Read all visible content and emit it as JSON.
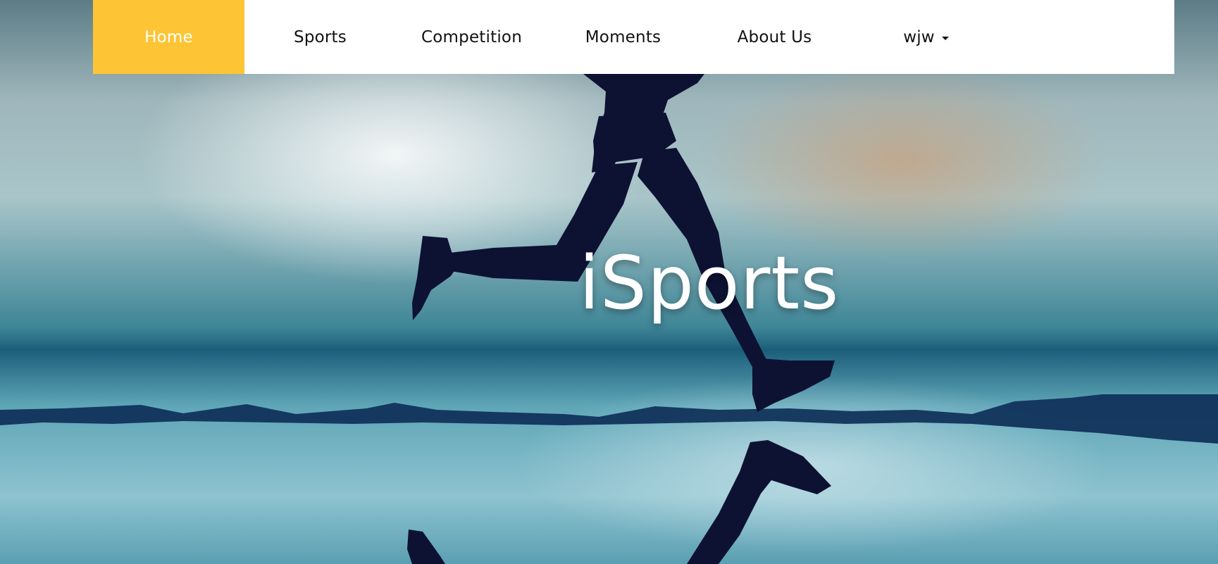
{
  "nav": {
    "items": [
      {
        "label": "Home",
        "active": true
      },
      {
        "label": "Sports",
        "active": false
      },
      {
        "label": "Competition",
        "active": false
      },
      {
        "label": "Moments",
        "active": false
      },
      {
        "label": "About Us",
        "active": false
      },
      {
        "label": "wjw",
        "active": false,
        "dropdown": true
      }
    ]
  },
  "hero": {
    "title": "iSports"
  },
  "colors": {
    "accent": "#fdc535",
    "nav_bg": "#ffffff",
    "silhouette": "#0d1233"
  }
}
